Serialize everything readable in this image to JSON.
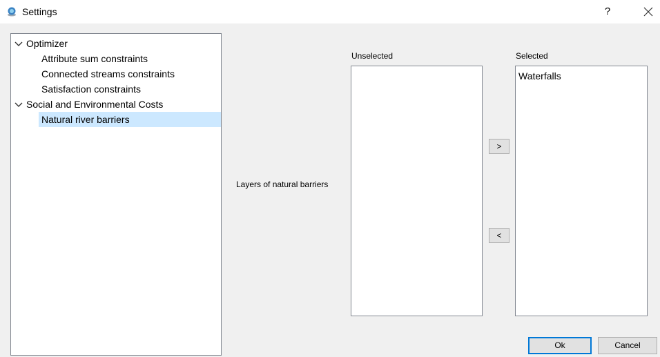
{
  "window": {
    "title": "Settings",
    "help_label": "?",
    "icons": {
      "app": "app-globe-icon",
      "close": "close-icon"
    }
  },
  "tree": {
    "items": [
      {
        "label": "Optimizer",
        "level": 0,
        "expanded": true
      },
      {
        "label": "Attribute sum constraints",
        "level": 1
      },
      {
        "label": "Connected streams constraints",
        "level": 1
      },
      {
        "label": "Satisfaction constraints",
        "level": 1
      },
      {
        "label": "Social and Environmental Costs",
        "level": 0,
        "expanded": true
      },
      {
        "label": "Natural river barriers",
        "level": 1,
        "selected": true
      }
    ]
  },
  "panel": {
    "field_label": "Layers of natural barriers",
    "unselected": {
      "caption": "Unselected",
      "items": []
    },
    "selected": {
      "caption": "Selected",
      "items": [
        "Waterfalls"
      ]
    },
    "add_label": ">",
    "remove_label": "<"
  },
  "buttons": {
    "ok": "Ok",
    "cancel": "Cancel"
  },
  "colors": {
    "selection": "#cce8ff",
    "default_button_border": "#0078d7"
  }
}
